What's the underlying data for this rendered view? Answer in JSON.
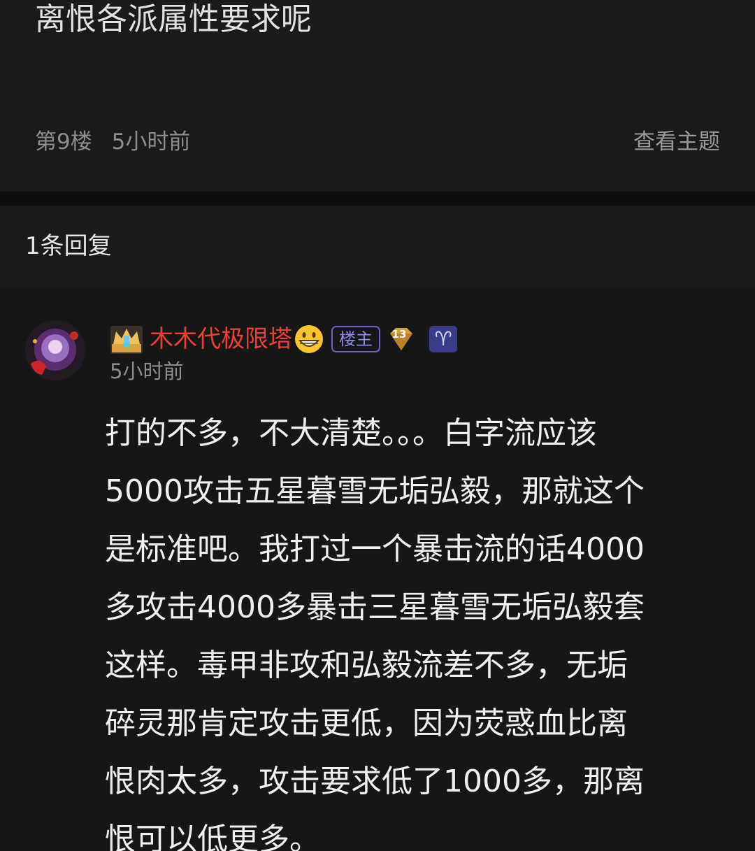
{
  "post": {
    "content": "离恨各派属性要求呢",
    "floor": "第9楼",
    "time": "5小时前",
    "view_topic_label": "查看主题"
  },
  "replies_header": {
    "count_label": "1条回复"
  },
  "reply": {
    "username": "木木代极限塔",
    "owner_badge": "楼主",
    "level": "13",
    "time": "5小时前",
    "icons": {
      "crown": "crown-icon",
      "emoji": "grinning-face-icon",
      "level": "level-gem-icon",
      "zodiac": "aries-icon"
    },
    "colors": {
      "username": "#ee3f36",
      "badge": "#6b63c9"
    },
    "content_lines": [
      "打的不多，不大清楚。。。白字流应该",
      "5000攻击五星暮雪无垢弘毅，那就这个",
      "是标准吧。我打过一个暴击流的话4000",
      "多攻击4000多暴击三星暮雪无垢弘毅套",
      "这样。毒甲非攻和弘毅流差不多，无垢",
      "碎灵那肯定攻击更低，因为荧惑血比离",
      "恨肉太多，攻击要求低了1000多，那离",
      "恨可以低更多。"
    ]
  }
}
